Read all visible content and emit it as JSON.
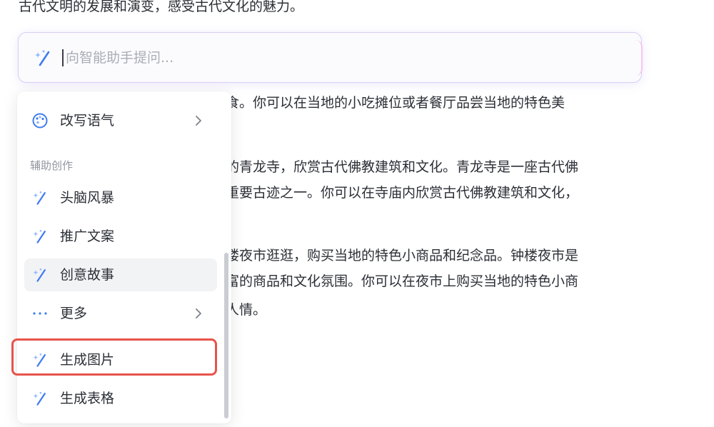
{
  "article": {
    "lines": [
      "古代文明的发展和演变，感受古代文化的魅力。",
      "食。你可以在当地的小吃摊位或者餐厅品尝当地的特色美",
      "的青龙寺，欣赏古代佛教建筑和文化。青龙寺是一座古代佛",
      "重要古迹之一。你可以在寺庙内欣赏古代佛教建筑和文化，",
      "楼夜市逛逛，购买当地的特色小商品和纪念品。钟楼夜市是",
      "富的商品和文化氛围。你可以在夜市上购买当地的特色小商",
      "人情。"
    ]
  },
  "prompt": {
    "placeholder": "向智能助手提问...",
    "value": "",
    "icon": "magic-wand-icon"
  },
  "menu": {
    "top_item": {
      "label": "改写语气",
      "icon": "palette-icon",
      "has_submenu": true
    },
    "section_label": "辅助创作",
    "items": [
      {
        "label": "头脑风暴",
        "icon": "magic-wand-icon"
      },
      {
        "label": "推广文案",
        "icon": "magic-wand-icon"
      },
      {
        "label": "创意故事",
        "icon": "magic-wand-icon"
      },
      {
        "label": "更多",
        "icon": "more-dots-icon",
        "has_submenu": true
      },
      {
        "label": "生成图片",
        "icon": "magic-wand-icon"
      },
      {
        "label": "生成表格",
        "icon": "magic-wand-icon"
      }
    ]
  },
  "colors": {
    "accent_blue": "#3f7cf0",
    "accent_light_blue": "#8fb4ff",
    "highlight_red": "#e8534a",
    "text": "#2b2f36",
    "muted": "#9095a0"
  }
}
